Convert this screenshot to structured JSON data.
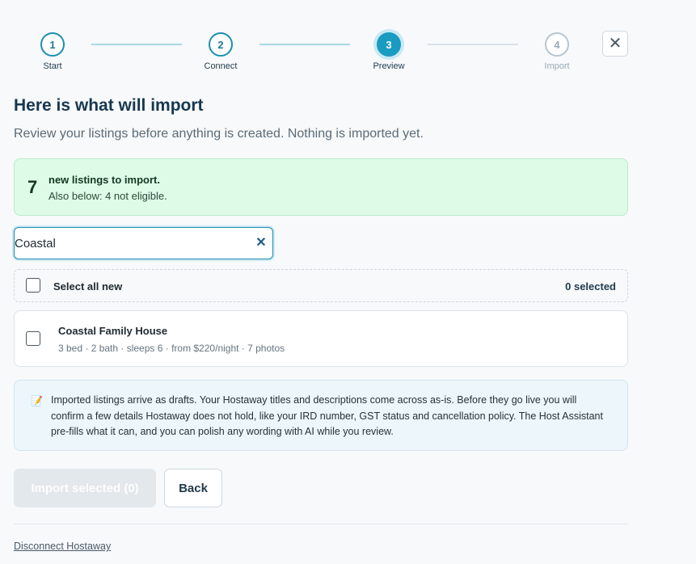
{
  "stepper": {
    "steps": [
      {
        "number": "1",
        "label": "Start",
        "state": "done"
      },
      {
        "number": "2",
        "label": "Connect",
        "state": "done"
      },
      {
        "number": "3",
        "label": "Preview",
        "state": "active"
      },
      {
        "number": "4",
        "label": "Import",
        "state": "future"
      }
    ],
    "close_icon": "close-icon",
    "close_glyph": "✕"
  },
  "header": {
    "title": "Here is what will import",
    "subtitle": "Review your listings before anything is created. Nothing is imported yet."
  },
  "summary": {
    "count": "7",
    "headline": "new listings to import.",
    "detail": "Also below: 4 not eligible."
  },
  "search": {
    "value": "Coastal",
    "clear_glyph": "✕",
    "clear_icon": "clear-icon"
  },
  "selection": {
    "select_all_label": "Select all new",
    "selected_count": "0 selected"
  },
  "listings": [
    {
      "title": "Coastal Family House",
      "meta": "3 bed · 2 bath · sleeps 6 · from $220/night · 7 photos"
    }
  ],
  "note": {
    "icon": "memo-icon",
    "glyph": "📝",
    "text": "Imported listings arrive as drafts. Your Hostaway titles and descriptions come across as-is. Before they go live you will confirm a few details Hostaway does not hold, like your IRD number, GST status and cancellation policy. The Host Assistant pre-fills what it can, and you can polish any wording with AI while you review."
  },
  "actions": {
    "import_label": "Import selected (0)",
    "back_label": "Back",
    "disconnect_label": "Disconnect Hostaway"
  },
  "colors": {
    "accent": "#1a9bc2",
    "success_bg": "#defbe7",
    "info_bg": "#edf6fa"
  }
}
